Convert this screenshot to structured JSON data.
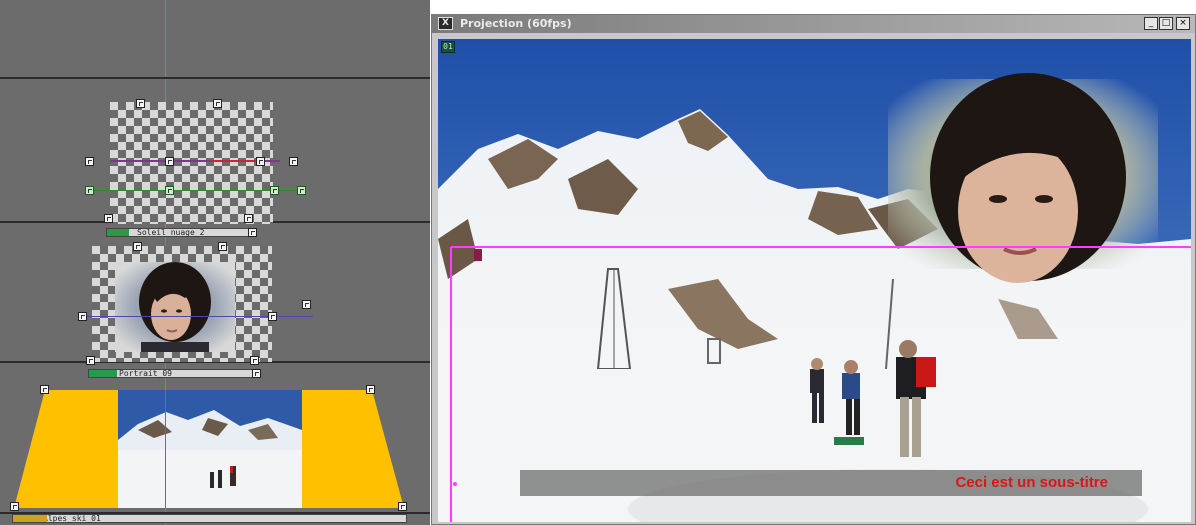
{
  "projection_window": {
    "title": "Projection (60fps)",
    "app_icon": "app-x-icon",
    "buttons": {
      "minimize": "_",
      "maximize": "□",
      "close": "×"
    },
    "frame_badge": "01"
  },
  "subtitle": {
    "text": "Ceci est un sous-titre",
    "color": "#d81818"
  },
  "timeline": {
    "clip1_label": "Soleil nuage_2",
    "clip2_label": "Portrait_09",
    "clip3_label": "Alpes_ski_01",
    "accent_color": "#ffc000",
    "selection_color": "#ff3cff",
    "track_bar_color": "#2a9a4a"
  }
}
